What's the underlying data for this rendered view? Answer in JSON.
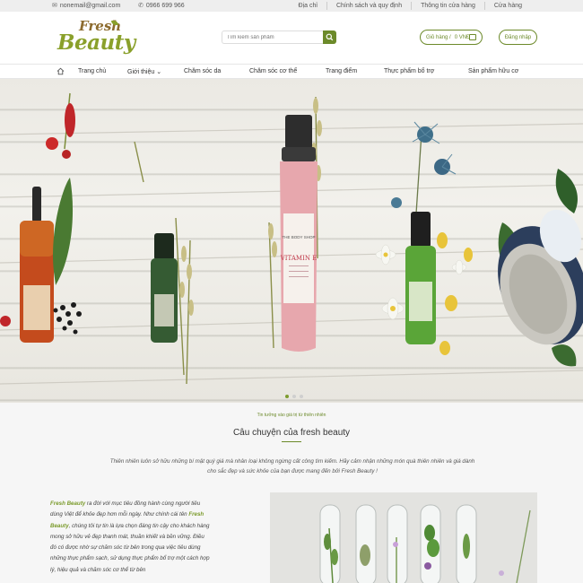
{
  "topbar": {
    "email": "nonemail@gmail.com",
    "phone": "0966 699 966",
    "links": [
      "Địa chỉ",
      "Chính sách và quy định",
      "Thông tin cửa hàng",
      "Cửa hàng"
    ]
  },
  "header": {
    "logo_line1": "Fresh",
    "logo_line2": "Beauty",
    "search_placeholder": "Tìm kiếm sản phẩm",
    "cart_label": "Giỏ hàng /",
    "cart_total": "0 VNĐ",
    "login_label": "Đăng nhập"
  },
  "nav": {
    "home_icon": "home-icon",
    "items": [
      "Trang chủ",
      "Giới thiệu ⌄",
      "Chăm sóc da",
      "Chăm sóc cơ thể",
      "Trang điểm",
      "Thực phẩm bổ trợ",
      "Sản phẩm hữu cơ"
    ]
  },
  "hero": {
    "bottle_label_brand": "THE BODY SHOP",
    "bottle_label_name": "VITAMIN E",
    "slider_count": 3,
    "slider_active": 1
  },
  "story": {
    "kicker": "Tin tưởng vào giá trị từ thiên nhiên",
    "title": "Câu chuyện của fresh beauty",
    "intro": "Thiên nhiên luôn sở hữu những bí mật quý giá mà nhân loại không ngừng cất công tìm kiếm. Hãy cảm nhận những món quà thiên nhiên và giá dành cho sắc đẹp và sức khỏe của bạn được mang đến bởi Fresh Beauty !",
    "body_hl1": "Fresh Beauty",
    "body_1": " ra đời với mục tiêu đồng hành cùng người tiêu dùng Việt để khỏe đẹp hơn mỗi ngày. Như chính cái tên ",
    "body_hl2": "Fresh Beauty",
    "body_2": ", chúng tôi tự tin là lựa chọn đáng tin cậy cho khách hàng mong sở hữu vẻ đẹp thanh mát, thuần khiết và bền vững. Điều đó có được nhờ sự chăm sóc từ bên trong qua việc tiêu dùng những thực phẩm sạch, sử dụng thực phẩm bổ trợ một cách hợp lý, hiệu quả và chăm sóc cơ thể từ bên"
  },
  "colors": {
    "accent": "#6c8a2a",
    "topbar_bg": "#eeeeee",
    "section_bg": "#f6f6f6"
  }
}
